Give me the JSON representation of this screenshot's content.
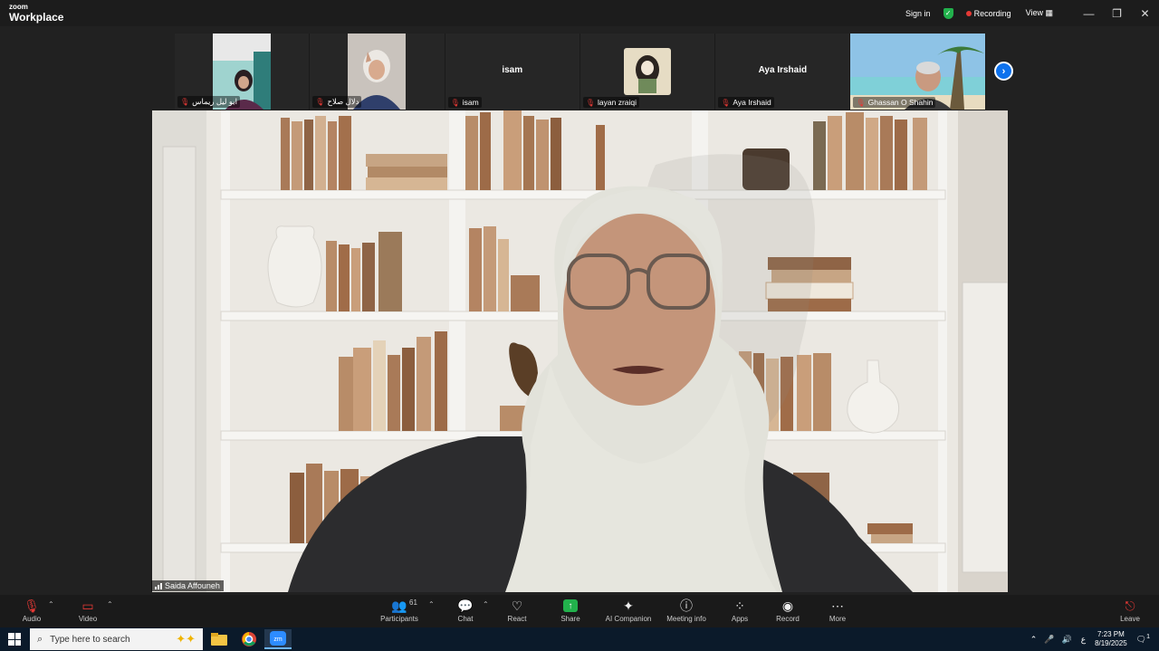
{
  "window": {
    "brand_top": "zoom",
    "brand_bottom": "Workplace",
    "sign_in": "Sign in",
    "recording": "Recording",
    "view": "View"
  },
  "participants_strip": [
    {
      "label": "ابو ليل  ريماس",
      "name_text": "",
      "has_video": true,
      "muted": true
    },
    {
      "label": "دلال صلاح",
      "name_text": "",
      "has_video": true,
      "muted": true
    },
    {
      "label": "isam",
      "name_text": "isam",
      "has_video": false,
      "muted": true
    },
    {
      "label": "layan zraiqi",
      "name_text": "",
      "has_video": true,
      "muted": true
    },
    {
      "label": "Aya Irshaid",
      "name_text": "Aya Irshaid",
      "has_video": false,
      "muted": true
    },
    {
      "label": "Ghassan O Shahin",
      "name_text": "",
      "has_video": true,
      "muted": true
    }
  ],
  "active_speaker": {
    "name": "Saida Affouneh"
  },
  "toolbar": {
    "audio": "Audio",
    "video": "Video",
    "participants": "Participants",
    "participants_count": "61",
    "chat": "Chat",
    "react": "React",
    "share": "Share",
    "ai_companion": "AI Companion",
    "meeting_info": "Meeting info",
    "apps": "Apps",
    "record": "Record",
    "more": "More",
    "leave": "Leave"
  },
  "taskbar": {
    "search_placeholder": "Type here to search",
    "lang": "ع",
    "time": "7:23 PM",
    "date": "8/19/2025",
    "notif_count": "1"
  },
  "colors": {
    "accent": "#0e72ed",
    "share": "#22b14c",
    "muted": "#e53935"
  }
}
